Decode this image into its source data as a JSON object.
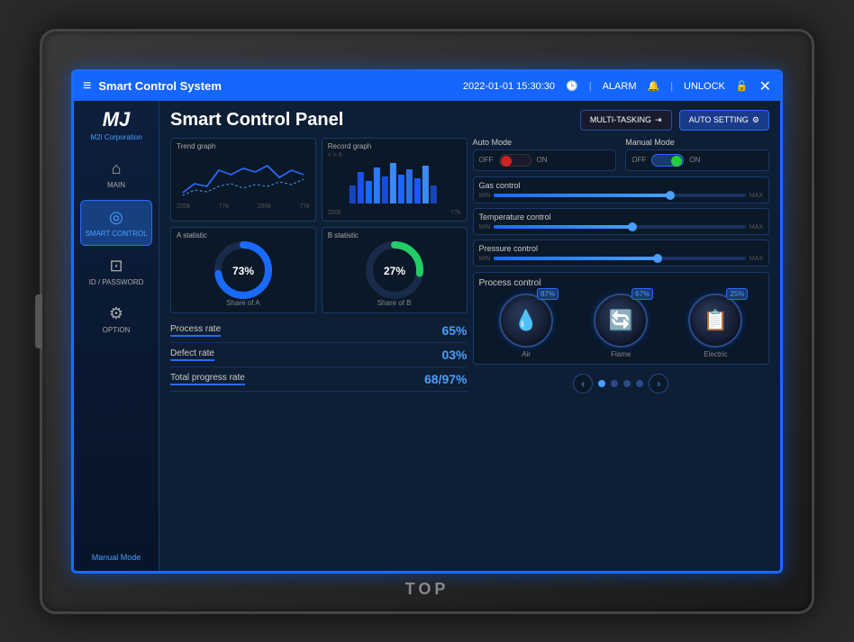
{
  "device": {
    "brand": "TOP"
  },
  "titlebar": {
    "menu_icon": "≡",
    "title": "Smart Control System",
    "datetime": "2022-01-01  15:30:30",
    "alarm_label": "ALARM",
    "unlock_label": "UNLOCK",
    "close_icon": "✕"
  },
  "sidebar": {
    "logo_text": "MJ",
    "corp_name": "M2I Corporation",
    "items": [
      {
        "label": "MAIN",
        "icon": "⌂",
        "active": false
      },
      {
        "label": "SMART CONTROL",
        "icon": "◎",
        "active": true
      },
      {
        "label": "ID / PASSWORD",
        "icon": "⊡",
        "active": false
      },
      {
        "label": "OPTION",
        "icon": "⚙",
        "active": false
      }
    ],
    "bottom_label": "Manual Mode"
  },
  "content": {
    "title": "Smart Control Panel",
    "buttons": {
      "multitasking": "MULTI-TASKING",
      "autosetting": "AUTO SETTING"
    },
    "charts": {
      "trend": {
        "title": "Trend graph",
        "labels": [
          "200k",
          "77k",
          "200k",
          "77k"
        ]
      },
      "record": {
        "title": "Record graph",
        "subtitle": "< > 5",
        "labels": [
          "200k",
          "77k"
        ]
      }
    },
    "stats": {
      "a": {
        "title": "A statistic",
        "value": "73%",
        "label": "Share of A",
        "color": "#1a6aff",
        "percent": 73
      },
      "b": {
        "title": "B statistic",
        "value": "27%",
        "label": "Share of B",
        "color": "#22cc66",
        "percent": 27
      }
    },
    "rates": [
      {
        "label": "Process rate",
        "value": "65%"
      },
      {
        "label": "Defect rate",
        "value": "03%"
      },
      {
        "label": "Total progress rate",
        "value": "68/97%"
      }
    ],
    "modes": {
      "auto": {
        "title": "Auto Mode",
        "state": "off"
      },
      "manual": {
        "title": "Manual Mode",
        "state": "on"
      }
    },
    "sliders": [
      {
        "title": "Gas control",
        "min": "MIN",
        "max": "MAX",
        "fill": 70
      },
      {
        "title": "Temperature control",
        "min": "MIN",
        "max": "MAX",
        "fill": 55
      },
      {
        "title": "Pressure control",
        "min": "MIN",
        "max": "MAX",
        "fill": 65
      }
    ],
    "process_control": {
      "title": "Process control",
      "knobs": [
        {
          "label": "Air",
          "value": "87%",
          "icon": "💧"
        },
        {
          "label": "Flame",
          "value": "67%",
          "icon": "🔄"
        },
        {
          "label": "Electric",
          "value": "25%",
          "icon": "📋"
        }
      ]
    },
    "pagination": {
      "dots": [
        true,
        false,
        false,
        false
      ]
    }
  }
}
